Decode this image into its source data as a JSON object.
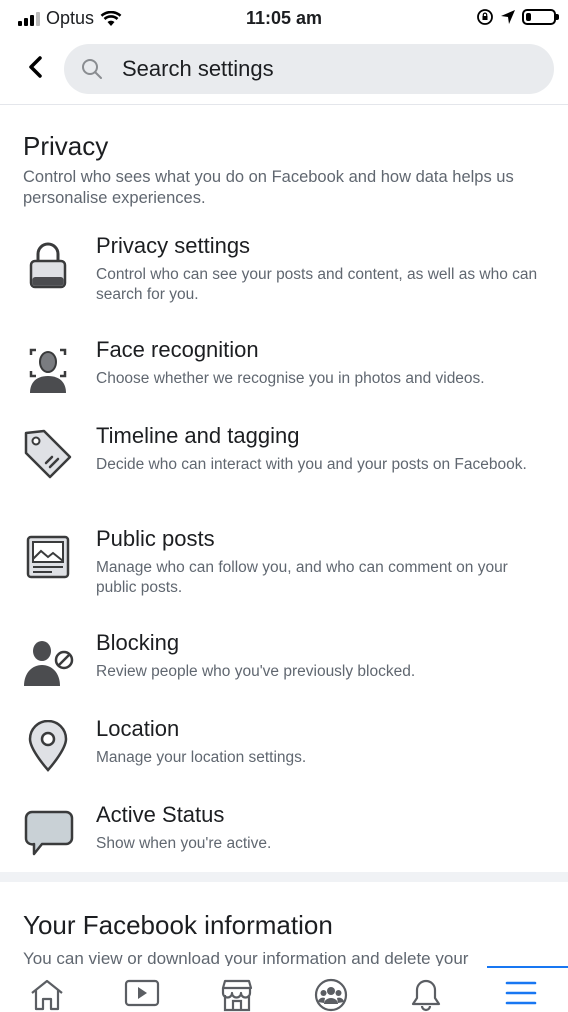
{
  "status": {
    "carrier": "Optus",
    "time": "11:05 am",
    "battery_level": 0.15
  },
  "search": {
    "placeholder": "Search settings"
  },
  "privacy": {
    "title": "Privacy",
    "description": "Control who sees what you do on Facebook and how data helps us personalise experiences.",
    "items": [
      {
        "icon": "lock-icon",
        "title": "Privacy settings",
        "description": "Control who can see your posts and content, as well as who can search for you."
      },
      {
        "icon": "face-recognition-icon",
        "title": "Face recognition",
        "description": "Choose whether we recognise you in photos and videos."
      },
      {
        "icon": "tag-icon",
        "title": "Timeline and tagging",
        "description": "Decide who can interact with you and your posts on Facebook."
      },
      {
        "icon": "public-posts-icon",
        "title": "Public posts",
        "description": "Manage who can follow you, and who can comment on your public posts."
      },
      {
        "icon": "blocking-icon",
        "title": "Blocking",
        "description": "Review people who you've previously blocked."
      },
      {
        "icon": "location-pin-icon",
        "title": "Location",
        "description": "Manage your location settings."
      },
      {
        "icon": "chat-bubble-icon",
        "title": "Active Status",
        "description": "Show when you're active."
      }
    ]
  },
  "your_info": {
    "title": "Your Facebook information",
    "description": "You can view or download your information and delete your"
  },
  "nav": {
    "items": [
      "home-icon",
      "watch-icon",
      "marketplace-icon",
      "groups-icon",
      "notifications-icon",
      "menu-icon"
    ],
    "active": "menu-icon",
    "active_color": "#1877f2"
  }
}
